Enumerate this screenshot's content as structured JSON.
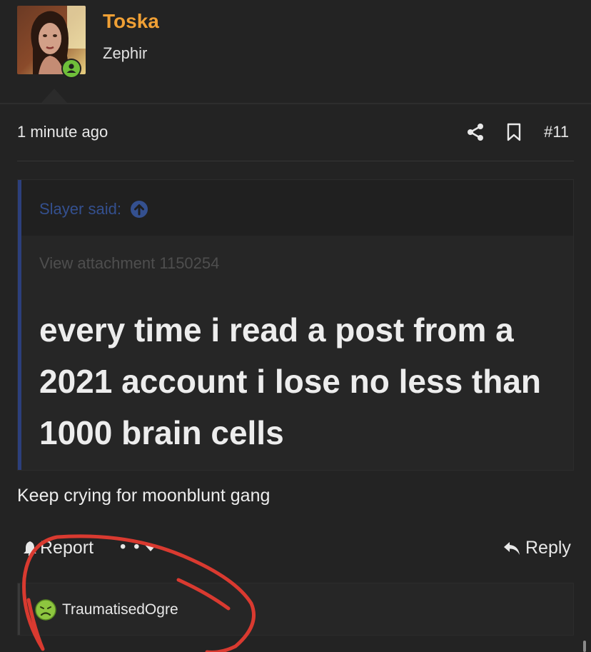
{
  "post_header": {
    "username": "Toska",
    "user_title": "Zephir"
  },
  "post_meta": {
    "timestamp": "1 minute ago",
    "post_number": "#11",
    "icons": [
      "share-icon",
      "bookmark-icon"
    ]
  },
  "quote": {
    "author_label": "Slayer said:",
    "attachment_label": "View attachment 1150254",
    "body": "every time i read a post from a 2021 account i lose no less than 1000 brain cells"
  },
  "post_body": "Keep crying for moonblunt gang",
  "actions": {
    "report_label": "Report",
    "more_label": "• • •",
    "reply_label": "Reply"
  },
  "reactions": {
    "users": [
      "TraumatisedOgre"
    ],
    "emoji": "sick-face-emoji"
  },
  "colors": {
    "background": "#232323",
    "username": "#f0a035",
    "quote_author": "#34508f",
    "quote_bar": "#2c3f7c",
    "online_badge": "#6fbf3a",
    "annotation": "#d93a30"
  }
}
